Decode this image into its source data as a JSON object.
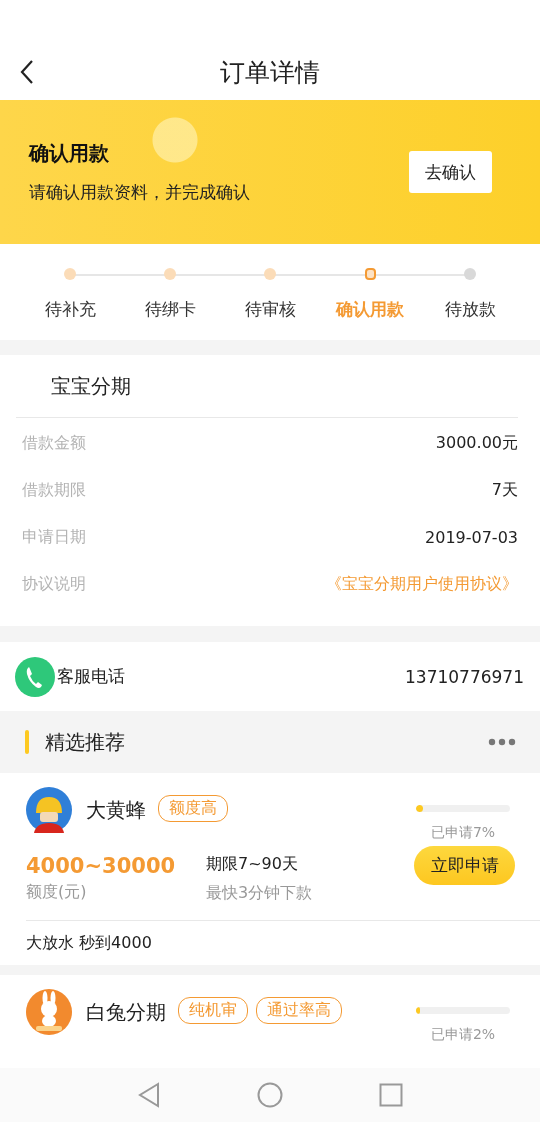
{
  "header": {
    "title": "订单详情"
  },
  "banner": {
    "title": "确认用款",
    "subtitle": "请确认用款资料，并完成确认",
    "button": "去确认"
  },
  "steps": [
    {
      "label": "待补充",
      "kind": "done",
      "selected": false
    },
    {
      "label": "待绑卡",
      "kind": "done",
      "selected": false
    },
    {
      "label": "待审核",
      "kind": "done",
      "selected": false
    },
    {
      "label": "确认用款",
      "kind": "current",
      "selected": true
    },
    {
      "label": "待放款",
      "kind": "pending",
      "selected": false
    }
  ],
  "loan": {
    "title": "宝宝分期",
    "rows": [
      {
        "label": "借款金额",
        "value": "3000.00元",
        "kind": "plain"
      },
      {
        "label": "借款期限",
        "value": "7天",
        "kind": "plain"
      },
      {
        "label": "申请日期",
        "value": "2019-07-03",
        "kind": "plain"
      },
      {
        "label": "协议说明",
        "value": "《宝宝分期用户使用协议》",
        "kind": "link"
      }
    ]
  },
  "service": {
    "label": "客服电话",
    "phone": "13710776971"
  },
  "recommend": {
    "title": "精选推荐",
    "products": [
      {
        "name": "大黄蜂",
        "kind": "helmet",
        "tags": [
          "额度高"
        ],
        "level": 0.07,
        "applied": "已申请7%",
        "amount": "4000~30000",
        "amount_label": "额度(元)",
        "term": "期限7~90天",
        "speed": "最快3分钟下款",
        "button": "立即申请",
        "note": "大放水 秒到4000"
      },
      {
        "name": "白兔分期",
        "kind": "rabbit",
        "tags": [
          "纯机审",
          "通过率高"
        ],
        "level": 0.02,
        "applied": "已申请2%"
      }
    ]
  }
}
